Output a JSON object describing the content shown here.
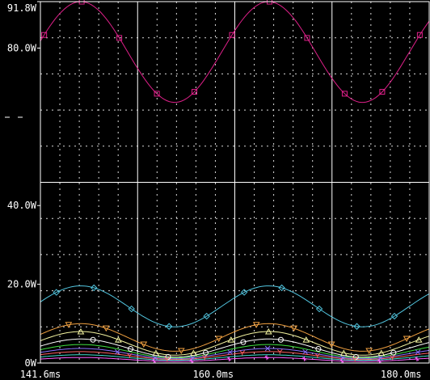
{
  "window": {
    "background": "#000000",
    "grid_color": "#ffffff"
  },
  "chart_data": {
    "type": "line",
    "title": "",
    "xlabel": "",
    "ylabel": "",
    "x_unit": "ms",
    "y_unit": "W",
    "xlim": [
      141.6,
      183.0
    ],
    "ylim": [
      0,
      91.8
    ],
    "x_ticks": [
      {
        "value": 141.6,
        "label": "141.6ms"
      },
      {
        "value": 160.0,
        "label": "160.0ms"
      },
      {
        "value": 180.0,
        "label": "180.0ms"
      }
    ],
    "y_ticks": [
      {
        "value": 0,
        "label": "0W"
      },
      {
        "value": 20.0,
        "label": "20.0W"
      },
      {
        "value": 40.0,
        "label": "40.0W"
      },
      {
        "value": 80.0,
        "label": "80.0W"
      },
      {
        "value": 91.8,
        "label": "91.8W"
      }
    ],
    "grid": true,
    "period_ms": 20.0,
    "series": [
      {
        "color": "#e0208a",
        "marker": "square",
        "mean": 79.0,
        "amplitude": 12.8,
        "phase_ms": 145.9
      },
      {
        "color": "#52c6e0",
        "marker": "diamond",
        "mean": 14.4,
        "amplitude": 5.2,
        "phase_ms": 145.9
      },
      {
        "color": "#f0a040",
        "marker": "triangle-down",
        "mean": 6.5,
        "amplitude": 3.5,
        "phase_ms": 145.9
      },
      {
        "color": "#f4f4a0",
        "marker": "triangle",
        "mean": 5.0,
        "amplitude": 3.0,
        "phase_ms": 145.9
      },
      {
        "color": "#ffffff",
        "marker": "circle",
        "mean": 3.8,
        "amplitude": 2.3,
        "phase_ms": 145.9
      },
      {
        "color": "#40e040",
        "marker": "none",
        "mean": 3.0,
        "amplitude": 1.7,
        "phase_ms": 145.9
      },
      {
        "color": "#8a70ff",
        "marker": "x",
        "mean": 2.4,
        "amplitude": 1.3,
        "phase_ms": 145.9
      },
      {
        "color": "#ff6060",
        "marker": "y",
        "mean": 1.9,
        "amplitude": 1.0,
        "phase_ms": 145.9
      },
      {
        "color": "#40e0d0",
        "marker": "none",
        "mean": 1.4,
        "amplitude": 0.7,
        "phase_ms": 145.9
      },
      {
        "color": "#ff60ff",
        "marker": "star",
        "mean": 0.9,
        "amplitude": 0.5,
        "phase_ms": 145.9
      }
    ]
  }
}
